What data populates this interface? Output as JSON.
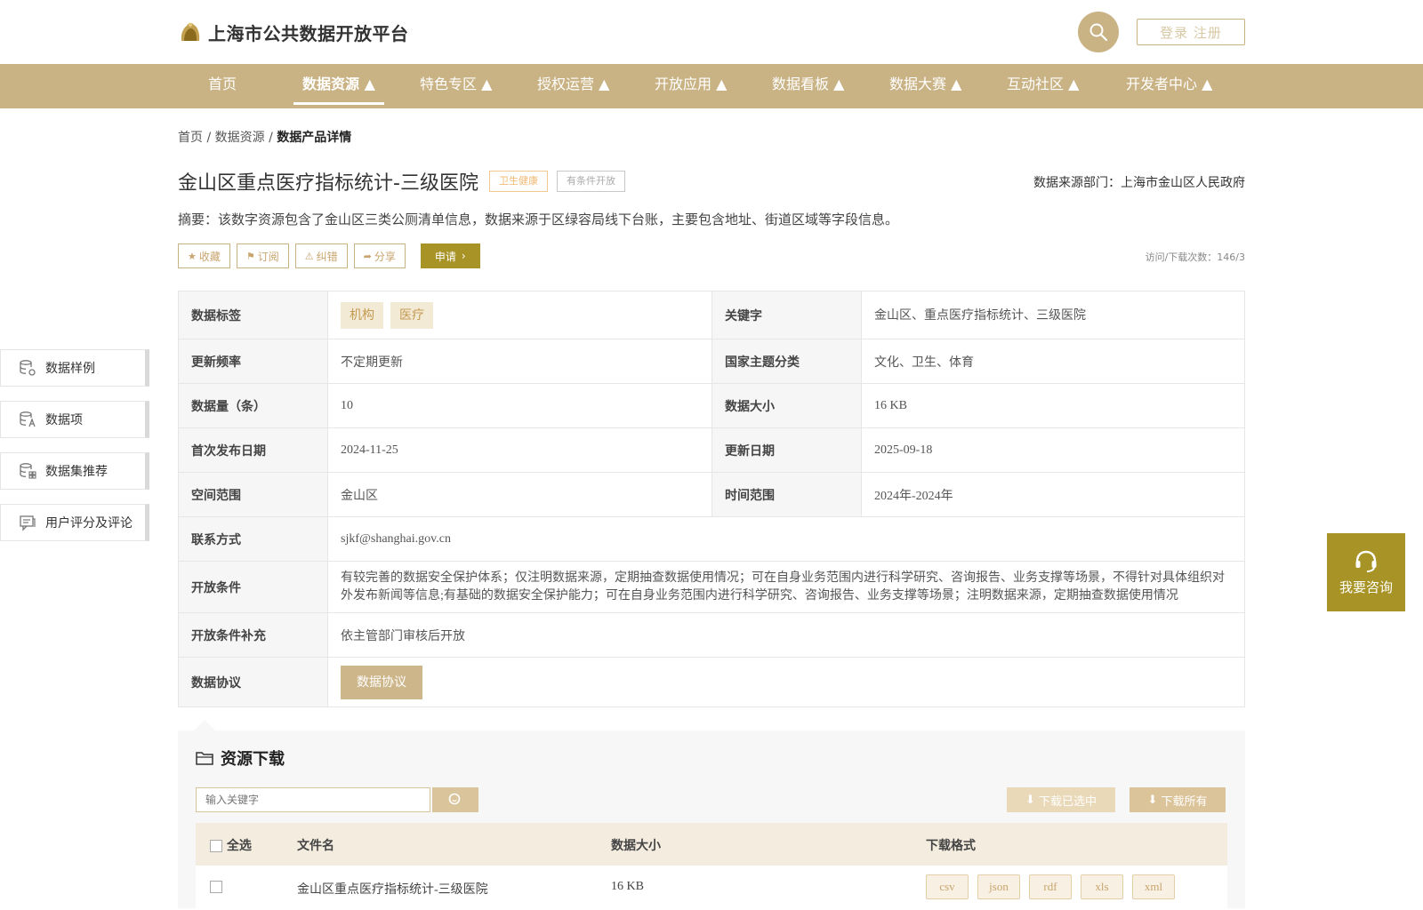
{
  "header": {
    "site_title": "上海市公共数据开放平台",
    "login_label": "登录 注册"
  },
  "nav": {
    "items": [
      {
        "label": "首页"
      },
      {
        "label": "数据资源 ▲"
      },
      {
        "label": "特色专区 ▲"
      },
      {
        "label": "授权运营 ▲"
      },
      {
        "label": "开放应用 ▲"
      },
      {
        "label": "数据看板 ▲"
      },
      {
        "label": "数据大赛 ▲"
      },
      {
        "label": "互动社区 ▲"
      },
      {
        "label": "开发者中心 ▲"
      }
    ],
    "active_index": 1
  },
  "breadcrumb": {
    "home": "首页",
    "sep1": " / ",
    "section": "数据资源",
    "sep2": " / ",
    "current": "数据产品详情"
  },
  "product": {
    "title": "金山区重点医疗指标统计-三级医院",
    "category_tag": "卫生健康",
    "open_type_tag": "有条件开放",
    "source": "数据来源部门：上海市金山区人民政府",
    "abstract": "摘要：该数字资源包含了金山区三类公厕清单信息，数据来源于区绿容局线下台账，主要包含地址、街道区域等字段信息。",
    "visits": "访问/下载次数：146/3"
  },
  "actions": {
    "favorite": "收藏",
    "subscribe": "订阅",
    "report": "纠错",
    "share": "分享",
    "apply": "申请"
  },
  "info": {
    "tags_label": "数据标签",
    "tags": [
      "机构",
      "医疗"
    ],
    "keywords_label": "关键字",
    "keywords": "金山区、重点医疗指标统计、三级医院",
    "freq_label": "更新频率",
    "freq": "不定期更新",
    "theme_label": "国家主题分类",
    "theme": "文化、卫生、体育",
    "count_label": "数据量（条）",
    "count": "10",
    "size_label": "数据大小",
    "size": "16 KB",
    "first_label": "首次发布日期",
    "first": "2024-11-25",
    "update_label": "更新日期",
    "update": "2025-09-18",
    "space_label": "空间范围",
    "space": "金山区",
    "time_label": "时间范围",
    "time": "2024年-2024年",
    "contact_label": "联系方式",
    "contact": "sjkf@shanghai.gov.cn",
    "cond_label": "开放条件",
    "cond": "有较完善的数据安全保护体系；仅注明数据来源，定期抽查数据使用情况；可在自身业务范围内进行科学研究、咨询报告、业务支撑等场景，不得针对具体组织对外发布新闻等信息;有基础的数据安全保护能力；可在自身业务范围内进行科学研究、咨询报告、业务支撑等场景；注明数据来源，定期抽查数据使用情况",
    "cond_sup_label": "开放条件补充",
    "cond_sup": "依主管部门审核后开放",
    "protocol_label": "数据协议",
    "protocol_btn": "数据协议"
  },
  "side": {
    "items": [
      {
        "label": "数据样例"
      },
      {
        "label": "数据项"
      },
      {
        "label": "数据集推荐"
      },
      {
        "label": "用户评分及评论"
      }
    ]
  },
  "consult": {
    "label": "我要咨询"
  },
  "download": {
    "title": "资源下载",
    "search_placeholder": "输入关键字",
    "download_selected": "下载已选中",
    "download_all": "下载所有",
    "headers": {
      "select_all": "全选",
      "filename": "文件名",
      "size": "数据大小",
      "format": "下载格式"
    },
    "rows": [
      {
        "filename": "金山区重点医疗指标统计-三级医院",
        "size": "16 KB",
        "formats": [
          "csv",
          "json",
          "rdf",
          "xls",
          "xml"
        ]
      }
    ]
  },
  "colors": {
    "accent": "#c9b283",
    "apply": "#a89326"
  }
}
